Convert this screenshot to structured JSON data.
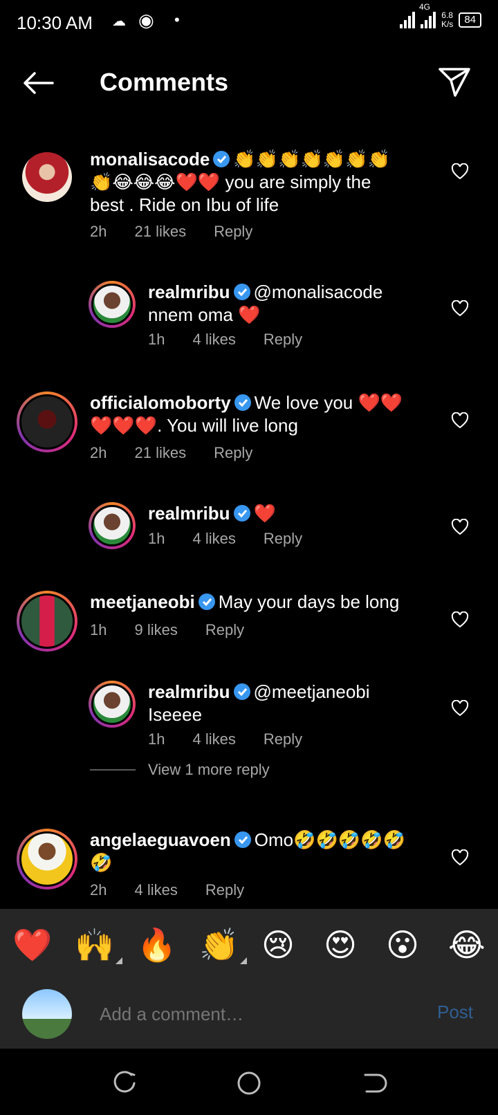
{
  "status": {
    "time": "10:30 AM",
    "network": "4G",
    "speed_top": "6.8",
    "speed_bottom": "K/s",
    "battery": "84"
  },
  "header": {
    "title": "Comments"
  },
  "comments": [
    {
      "username": "monalisacode",
      "text_line1": "👏👏👏👏👏👏👏",
      "text_line2": "👏😂😂😂❤️❤️ you are simply the",
      "text_line3": "best . Ride on Ibu of life",
      "time": "2h",
      "likes": "21 likes",
      "reply": "Reply"
    },
    {
      "username": "realmribu",
      "text_line1": "@monalisacode",
      "text_line2": "nnem oma ❤️",
      "time": "1h",
      "likes": "4 likes",
      "reply": "Reply"
    },
    {
      "username": "officialomoborty",
      "text_line1": "We love you ❤️❤️",
      "text_line2": "❤️❤️❤️. You will live long",
      "time": "2h",
      "likes": "21 likes",
      "reply": "Reply"
    },
    {
      "username": "realmribu",
      "text_line1": "❤️",
      "time": "1h",
      "likes": "4 likes",
      "reply": "Reply"
    },
    {
      "username": "meetjaneobi",
      "text_line1": "May your days be long",
      "time": "1h",
      "likes": "9 likes",
      "reply": "Reply"
    },
    {
      "username": "realmribu",
      "text_line1": "@meetjaneobi",
      "text_line2": "Iseeee",
      "time": "1h",
      "likes": "4 likes",
      "reply": "Reply"
    },
    {
      "username": "angelaeguavoen",
      "text_line1": "Omo🤣🤣🤣🤣🤣",
      "text_line2": "🤣",
      "time": "2h",
      "likes": "4 likes",
      "reply": "Reply"
    }
  ],
  "view_more": "View 1 more reply",
  "emoji_bar": [
    "❤️",
    "🙌",
    "🔥",
    "👏",
    "😢",
    "😍",
    "😮",
    "😂"
  ],
  "input": {
    "placeholder": "Add a comment…",
    "post_label": "Post"
  },
  "icons": {
    "verified": "verified-badge-icon",
    "heart": "heart-outline-icon",
    "back": "arrow-left-icon",
    "send": "paper-plane-icon"
  },
  "colors": {
    "background": "#000000",
    "verified": "#3897f0",
    "post_disabled": "#2f5f93",
    "meta_gray": "#a8a8a8"
  }
}
